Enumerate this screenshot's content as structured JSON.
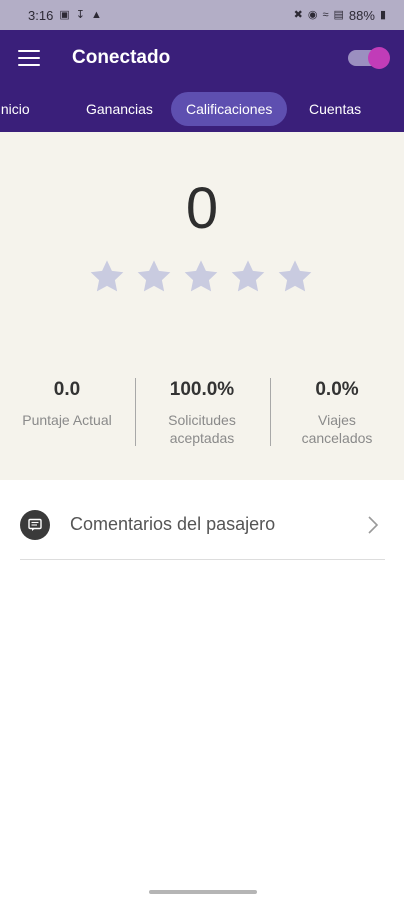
{
  "status_bar": {
    "time": "3:16",
    "battery": "88%",
    "left_icons": [
      "image-icon",
      "download-icon",
      "warning-icon"
    ],
    "right_icons": [
      "mute-icon",
      "location-icon",
      "wifi-icon",
      "signal-icon",
      "battery-icon"
    ]
  },
  "header": {
    "title": "Conectado",
    "online_toggle_on": true,
    "colors": {
      "background": "#3a1f7a",
      "toggle_knob": "#c13cb8"
    }
  },
  "tabs": [
    {
      "label": "Inicio",
      "active": false
    },
    {
      "label": "Ganancias",
      "active": false
    },
    {
      "label": "Calificaciones",
      "active": true
    },
    {
      "label": "Cuentas",
      "active": false
    }
  ],
  "rating": {
    "score": "0",
    "stars_total": 5,
    "stars_filled": 0,
    "star_color": "#c9cbe0"
  },
  "stats": [
    {
      "value": "0.0",
      "label": "Puntaje Actual"
    },
    {
      "value": "100.0%",
      "label": "Solicitudes aceptadas"
    },
    {
      "value": "0.0%",
      "label": "Viajes cancelados"
    }
  ],
  "comments": {
    "label": "Comentarios del pasajero"
  }
}
